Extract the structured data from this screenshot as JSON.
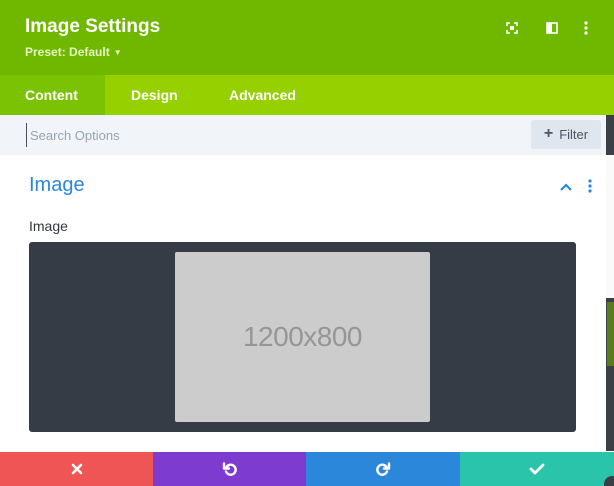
{
  "header": {
    "title": "Image Settings",
    "preset_label": "Preset: Default",
    "icons": [
      "fullscreen-icon",
      "sidebar-toggle-icon",
      "more-vertical-icon"
    ],
    "background_color": "#70b800"
  },
  "tabs": [
    {
      "label": "Content",
      "active": true
    },
    {
      "label": "Design",
      "active": false
    },
    {
      "label": "Advanced",
      "active": false
    }
  ],
  "search": {
    "placeholder": "Search Options",
    "value": "",
    "filter_label": "Filter"
  },
  "section": {
    "title": "Image",
    "field_label": "Image",
    "image_placeholder_text": "1200x800"
  },
  "footer": {
    "buttons": [
      {
        "name": "cancel",
        "icon": "close-icon",
        "color": "#ef5555"
      },
      {
        "name": "undo",
        "icon": "undo-icon",
        "color": "#7e3bd0"
      },
      {
        "name": "redo",
        "icon": "redo-icon",
        "color": "#2b87da"
      },
      {
        "name": "save",
        "icon": "check-icon",
        "color": "#29c4a9"
      }
    ]
  },
  "colors": {
    "accent_blue": "#2b87da",
    "tab_bar": "#97d000",
    "active_tab": "#7cc204"
  }
}
